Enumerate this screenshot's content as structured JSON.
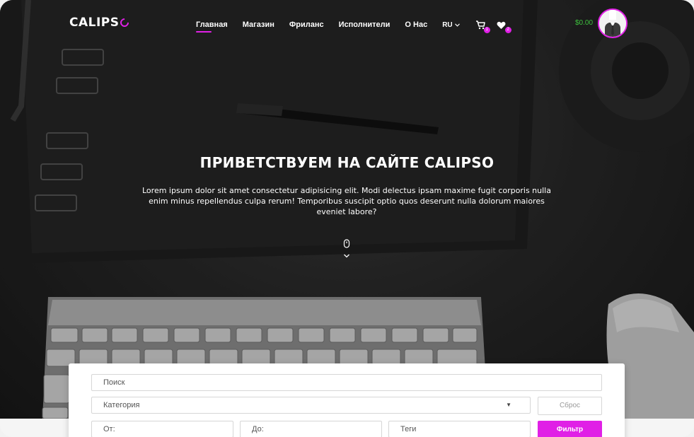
{
  "header": {
    "logo": "CALIPS",
    "nav": [
      {
        "label": "Главная",
        "active": true
      },
      {
        "label": "Магазин",
        "active": false
      },
      {
        "label": "Фриланс",
        "active": false
      },
      {
        "label": "Исполнители",
        "active": false
      },
      {
        "label": "О Нас",
        "active": false
      }
    ],
    "language": "RU",
    "cart_count": "1",
    "wishlist_count": "2",
    "balance": "$0.00",
    "icons": {
      "language": "chevron-down-icon",
      "cart": "cart-icon",
      "wishlist": "heart-icon",
      "avatar": "user-avatar"
    }
  },
  "hero": {
    "title": "ПРИВЕТСТВУЕМ НА САЙТЕ CALIPSO",
    "text": "Lorem ipsum dolor sit amet consectetur adipisicing elit. Modi delectus ipsam maxime fugit corporis nulla enim minus repellendus culpa rerum! Temporibus suscipit optio quos deserunt nulla dolorum maiores eveniet labore?",
    "scroll_icon": "mouse-scroll-icon"
  },
  "filter": {
    "search_placeholder": "Поиск",
    "category_placeholder": "Категория",
    "from_placeholder": "От:",
    "to_placeholder": "До:",
    "tags_placeholder": "Теги",
    "reset_label": "Сброс",
    "filter_label": "Фильтр"
  },
  "colors": {
    "accent": "#e020e6",
    "balance": "#3ec33e"
  }
}
